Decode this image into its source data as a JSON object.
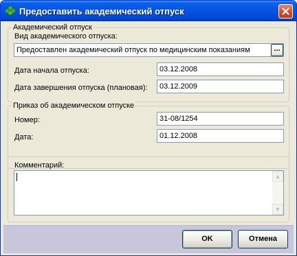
{
  "window": {
    "title": "Предоставить академический отпуск"
  },
  "leave_group": {
    "title": "Академический отпуск",
    "type_label": "Вид академического отпуска:",
    "type_value": "Предоставлен академический отпуск по медицинским показаниям",
    "ellipsis_label": "...",
    "start_label": "Дата начала отпуска:",
    "start_value": "03.12.2008",
    "end_label": "Дата завершения отпуска (плановая):",
    "end_value": "03.12.2009"
  },
  "order_group": {
    "title": "Приказ об академическом отпуске",
    "number_label": "Номер:",
    "number_value": "31-08/1254",
    "date_label": "Дата:",
    "date_value": "01.12.2008"
  },
  "comment_group": {
    "label": "Комментарий:",
    "value": ""
  },
  "buttons": {
    "ok": "OK",
    "cancel": "Отмена"
  },
  "colors": {
    "titlebar": "#0554e2",
    "dialog_bg": "#ece9d8",
    "footer_bg": "#c8c6da",
    "field_border": "#7f9db9"
  }
}
